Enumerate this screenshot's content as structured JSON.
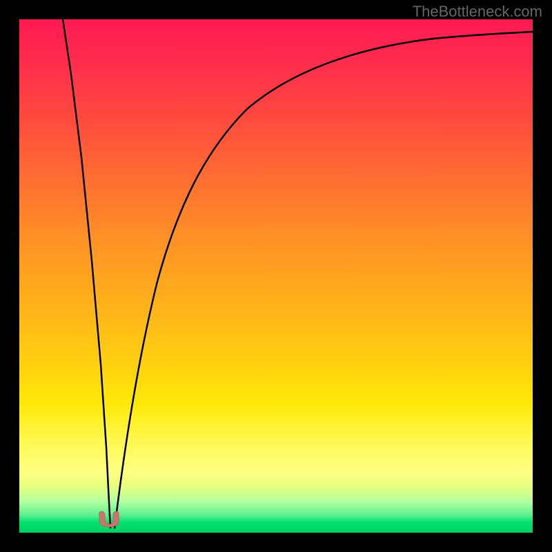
{
  "attribution": "TheBottleneck.com",
  "chart_data": {
    "type": "line",
    "title": "",
    "xlabel": "",
    "ylabel": "",
    "xlim": [
      0,
      100
    ],
    "ylim": [
      0,
      100
    ],
    "background_gradient": {
      "orientation": "vertical",
      "stops": [
        {
          "pos": 0,
          "color": "#ff1a52"
        },
        {
          "pos": 50,
          "color": "#ffb01b"
        },
        {
          "pos": 85,
          "color": "#ffff80"
        },
        {
          "pos": 100,
          "color": "#00d060"
        }
      ],
      "meaning": "red=high bottleneck, green=optimal"
    },
    "series": [
      {
        "name": "left-branch",
        "description": "steep descent from top-left to minimum",
        "x": [
          8.5,
          10,
          12,
          14,
          16,
          17,
          17.5
        ],
        "y": [
          100,
          80,
          55,
          32,
          14,
          4,
          0
        ]
      },
      {
        "name": "right-branch",
        "description": "asymptotic rise from minimum toward top-right",
        "x": [
          17.5,
          20,
          24,
          30,
          38,
          48,
          60,
          75,
          90,
          100
        ],
        "y": [
          0,
          18,
          42,
          62,
          76,
          85,
          90,
          93,
          95,
          96
        ]
      }
    ],
    "marker": {
      "x": 17.5,
      "y": 0,
      "shape": "u-shape",
      "color": "#c4776b",
      "meaning": "optimal point / current configuration"
    }
  }
}
